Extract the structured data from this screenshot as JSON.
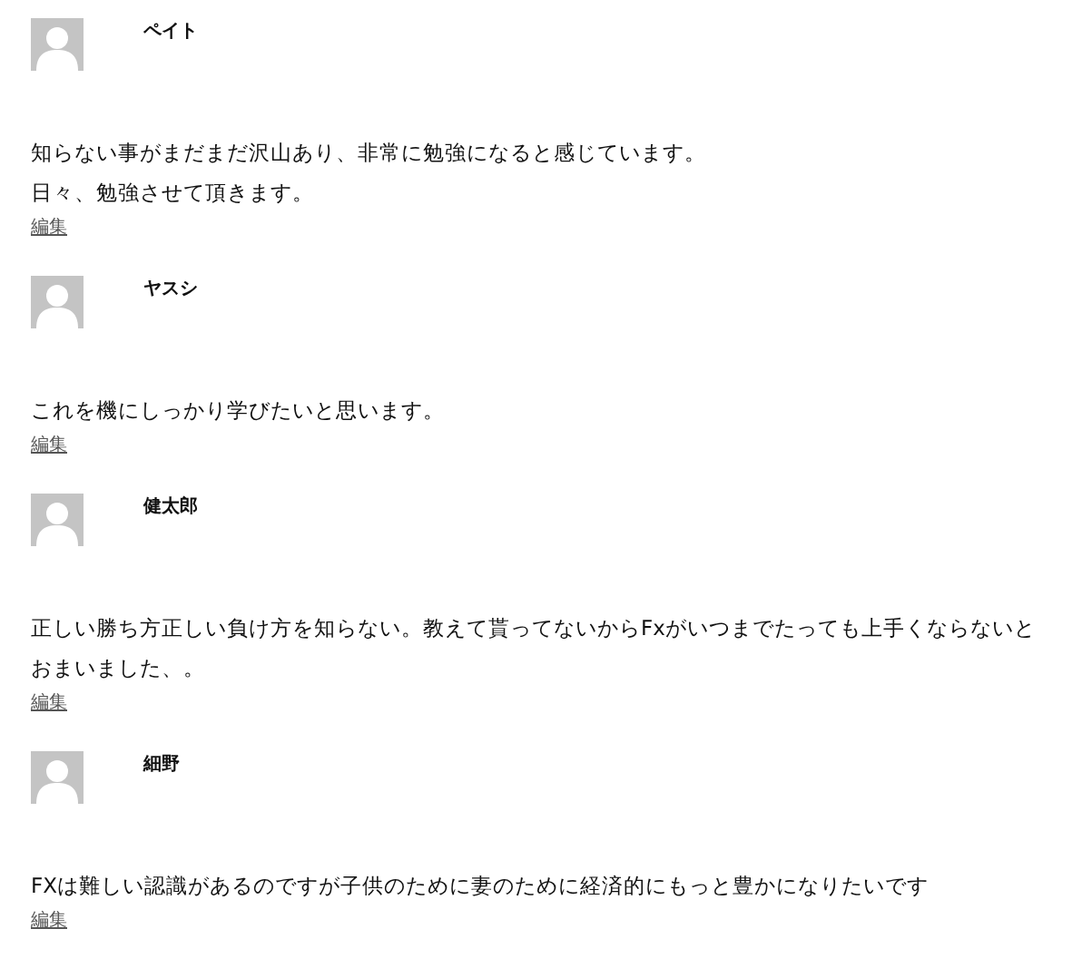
{
  "comments": [
    {
      "author": "ペイト",
      "text": "知らない事がまだまだ沢山あり、非常に勉強になると感じています。",
      "text_2": "日々、勉強させて頂きます。",
      "edit_link": "編集"
    },
    {
      "author": "ヤスシ",
      "text": "これを機にしっかり学びたいと思います。",
      "edit_link": "編集"
    },
    {
      "author": "健太郎",
      "text": "正しい勝ち方正しい負け方を知らない。教えて貰ってないからFxがいつまでたっても上手くならないとおまいました、。",
      "edit_link": "編集"
    },
    {
      "author": "細野",
      "text": "FXは難しい認識があるのですが子供のために妻のために経済的にもっと豊かになりたいです",
      "edit_link": "編集"
    }
  ]
}
